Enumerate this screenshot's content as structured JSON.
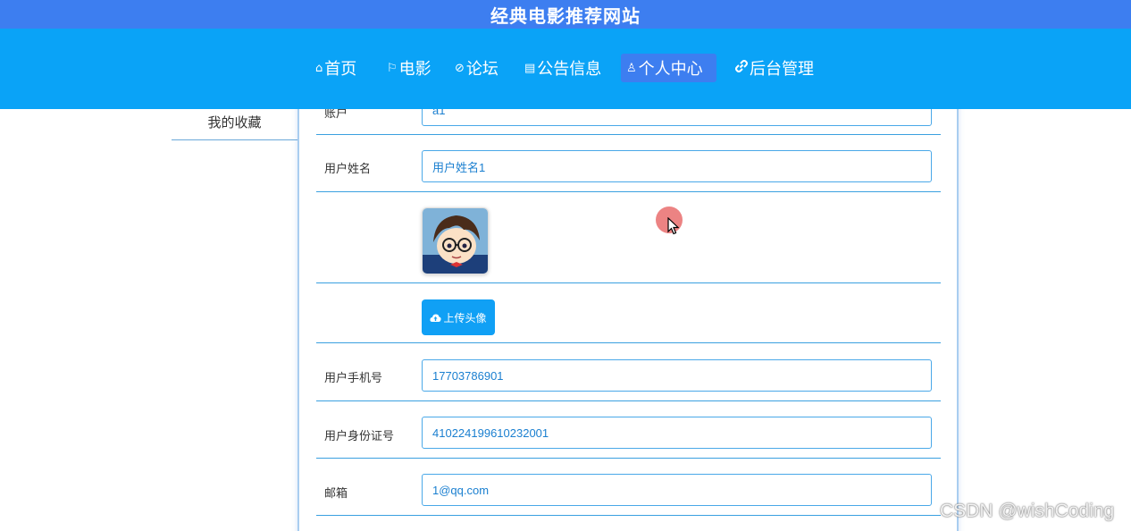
{
  "header": {
    "site_title": "经典电影推荐网站",
    "nav": [
      {
        "label": "首页",
        "icon": "home-icon",
        "glyph": "⌂"
      },
      {
        "label": "电影",
        "icon": "flag-icon",
        "glyph": "⚐"
      },
      {
        "label": "论坛",
        "icon": "tag-icon",
        "glyph": "⊘"
      },
      {
        "label": "公告信息",
        "icon": "document-icon",
        "glyph": "▤"
      },
      {
        "label": "个人中心",
        "icon": "user-icon",
        "glyph": "♙",
        "active": true
      },
      {
        "label": "后台管理",
        "icon": "link-icon",
        "glyph": "🔗"
      }
    ]
  },
  "sidebar": {
    "items": [
      {
        "label": "我的收藏"
      }
    ]
  },
  "form": {
    "account": {
      "label": "账户",
      "value": "a1"
    },
    "username": {
      "label": "用户姓名",
      "value": "用户姓名1"
    },
    "avatar": {
      "alt": "avatar"
    },
    "upload_button": {
      "label": "上传头像",
      "icon": "cloud-upload-icon"
    },
    "phone": {
      "label": "用户手机号",
      "value": "17703786901"
    },
    "id_card": {
      "label": "用户身份证号",
      "value": "410224199610232001"
    },
    "email": {
      "label": "邮箱",
      "value": "1@qq.com"
    }
  },
  "watermark": "CSDN @wishCoding",
  "colors": {
    "title_bar": "#3d7ef0",
    "nav_bar": "#0aa3f7",
    "active_nav": "#3d7ef0",
    "input_border": "#4aa8e8",
    "upload_button": "#10a0f5"
  }
}
